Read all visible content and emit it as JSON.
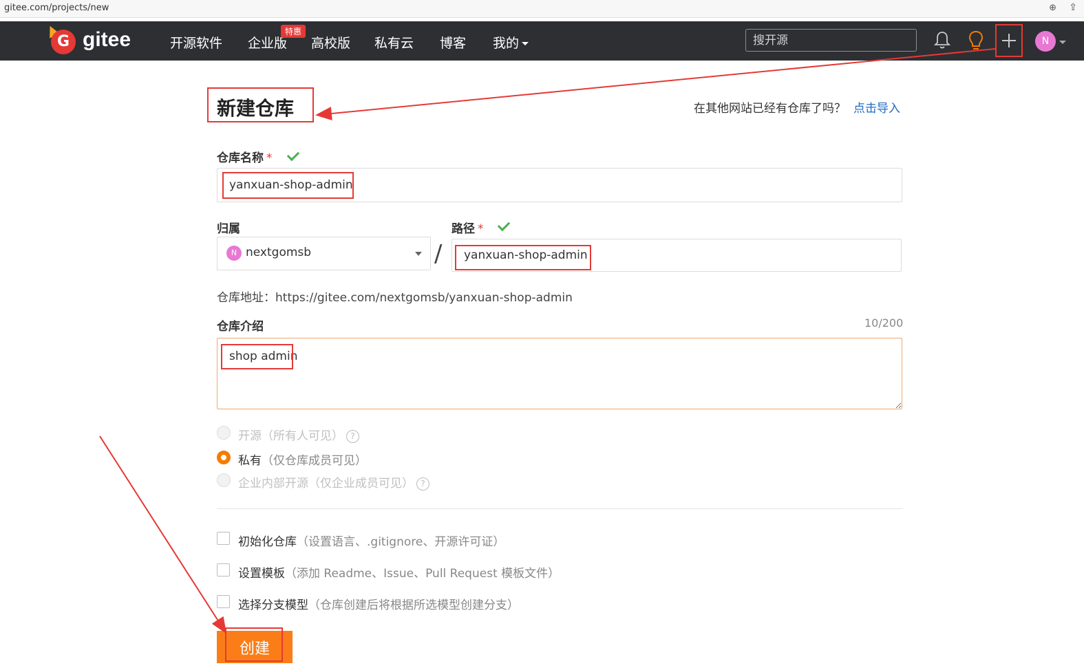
{
  "browser": {
    "url": "gitee.com/projects/new",
    "zoom_icon": "zoom-icon",
    "share_icon": "share-icon"
  },
  "header": {
    "logo_text": "gitee",
    "nav": [
      "开源软件",
      "企业版",
      "高校版",
      "私有云",
      "博客",
      "我的"
    ],
    "enterprise_badge": "特惠",
    "search_placeholder": "搜开源",
    "avatar_letter": "N",
    "icons": [
      "bell-icon",
      "lightbulb-icon",
      "plus-icon",
      "chevron-down-icon"
    ]
  },
  "page": {
    "title": "新建仓库",
    "import_question": "在其他网站已经有仓库了吗？",
    "import_link": "点击导入"
  },
  "form": {
    "repo_name_label": "仓库名称",
    "required_mark": "*",
    "repo_name_value": "yanxuan-shop-admin",
    "owner_label": "归属",
    "owner_avatar": "N",
    "owner_value": "nextgomsb",
    "path_separator": "/",
    "path_label": "路径",
    "path_value": "yanxuan-shop-admin",
    "repo_address_label": "仓库地址：",
    "repo_address": "https://gitee.com/nextgomsb/yanxuan-shop-admin",
    "intro_label": "仓库介绍",
    "intro_counter": "10/200",
    "intro_value": "shop admin",
    "visibility": [
      {
        "label": "开源",
        "hint": "（所有人可见）",
        "selected": false,
        "disabled": true
      },
      {
        "label": "私有",
        "hint": "（仅仓库成员可见）",
        "selected": true,
        "disabled": false
      },
      {
        "label": "企业内部开源",
        "hint": "（仅企业成员可见）",
        "selected": false,
        "disabled": true
      }
    ],
    "options": [
      {
        "label": "初始化仓库",
        "hint": "（设置语言、.gitignore、开源许可证）"
      },
      {
        "label": "设置模板",
        "hint": "（添加 Readme、Issue、Pull Request 模板文件）"
      },
      {
        "label": "选择分支模型",
        "hint": "（仓库创建后将根据所选模型创建分支）"
      }
    ],
    "submit_label": "创建"
  },
  "colors": {
    "header_bg": "#2d2f33",
    "accent_orange": "#fa7d18",
    "link_blue": "#1e6bbf",
    "annotation_red": "#e53935",
    "check_green": "#4caf50"
  }
}
